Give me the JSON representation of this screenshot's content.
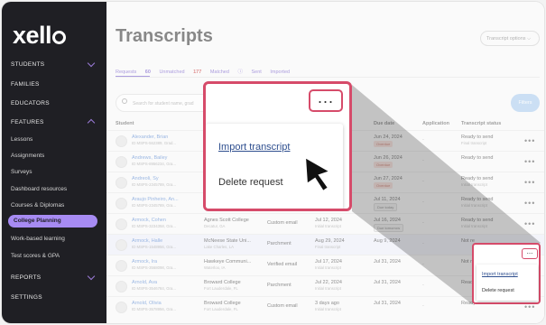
{
  "app": {
    "logo": "xell",
    "logo_suffix": "o"
  },
  "sidebar": {
    "sections": [
      {
        "label": "STUDENTS",
        "chevron": "down"
      },
      {
        "label": "FAMILIES"
      },
      {
        "label": "EDUCATORS"
      },
      {
        "label": "FEATURES",
        "chevron": "up"
      }
    ],
    "features_items": [
      "Lessons",
      "Assignments",
      "Surveys",
      "Dashboard resources",
      "Courses & Diplomas"
    ],
    "active_item": "College Planning",
    "after_items": [
      "Work-based learning",
      "Test scores & GPA"
    ],
    "bottom_sections": [
      {
        "label": "REPORTS",
        "chevron": "down"
      },
      {
        "label": "SETTINGS"
      }
    ]
  },
  "header": {
    "title": "Transcripts",
    "options_button": "Transcript options"
  },
  "tabs": [
    {
      "label": "Requests",
      "count": "60"
    },
    {
      "label": "Unmatched",
      "count": "177"
    },
    {
      "label": "Matched",
      "count": ""
    },
    {
      "label": "Sent",
      "count": ""
    },
    {
      "label": "Imported",
      "count": ""
    }
  ],
  "search": {
    "placeholder": "Search for student name, grad"
  },
  "filters_button": "Filters",
  "table": {
    "headers": {
      "student": "Student",
      "due_date": "Due date",
      "application": "Application",
      "status": "Transcript status"
    },
    "rows": [
      {
        "name": "Alexander, Brian",
        "id": "ID MSPS-562389, Grad...",
        "college": "",
        "college_loc": "",
        "method": "",
        "received": "",
        "received_sub": "",
        "due": "Jun 24, 2024",
        "badge": "Overdue",
        "badge_type": "over",
        "app": "-",
        "status": "Ready to send",
        "status_sub": "Final transcript"
      },
      {
        "name": "Andrews, Bailey",
        "id": "ID MSPS-8956234, Gra...",
        "college": "",
        "college_loc": "",
        "method": "",
        "received": "",
        "received_sub": "",
        "due": "Jun 26, 2024",
        "badge": "Overdue",
        "badge_type": "over",
        "app": "-",
        "status": "Ready to send",
        "status_sub": ""
      },
      {
        "name": "Andreoli, Sy",
        "id": "ID MSPS-2345789, Gra...",
        "college": "",
        "college_loc": "",
        "method": "",
        "received": "",
        "received_sub": "",
        "due": "Jun 27, 2024",
        "badge": "Overdue",
        "badge_type": "over",
        "app": "-",
        "status": "Ready to send",
        "status_sub": "Initial transcript"
      },
      {
        "name": "Araujo Pinheiro, An...",
        "id": "ID MSPS-2345789, Gra...",
        "college": "",
        "college_loc": "",
        "method": "",
        "received": "",
        "received_sub": "",
        "due": "Jul 11, 2024",
        "badge": "Due today",
        "badge_type": "ok",
        "app": "-",
        "status": "Ready to send",
        "status_sub": "Initial transcript"
      },
      {
        "name": "Armock, Cohen",
        "id": "ID MSPS-3234358, Gra...",
        "college": "Agnes Scott College",
        "college_loc": "Decatur, GA",
        "method": "Custom email",
        "received": "Jul 12, 2024",
        "received_sub": "Initial transcript",
        "due": "Jul 16, 2024",
        "badge": "Due tomorrow",
        "badge_type": "ok",
        "app": "-",
        "status": "Ready to send",
        "status_sub": "Initial transcript"
      },
      {
        "name": "Armock, Halle",
        "id": "ID MSPS-1548956, Gra...",
        "college": "McNeese State Uni...",
        "college_loc": "Lake Charles, LA",
        "method": "Parchment",
        "received": "Aug 29, 2024",
        "received_sub": "Final transcript",
        "due": "Aug 9, 2024",
        "badge": "",
        "badge_type": "",
        "app": "-",
        "status": "Not re",
        "status_sub": ""
      },
      {
        "name": "Armock, Ira",
        "id": "ID MSPS-3568098, Gra...",
        "college": "Hawkeye Communi...",
        "college_loc": "Waterloo, IA",
        "method": "Verified email",
        "received": "Jul 17, 2024",
        "received_sub": "Initial transcript",
        "due": "Jul 31, 2024",
        "badge": "",
        "badge_type": "",
        "app": "-",
        "status": "Not re",
        "status_sub": ""
      },
      {
        "name": "Arnold, Ava",
        "id": "ID MSPS-3546784, Gra...",
        "college": "Broward College",
        "college_loc": "Fort Lauderdale, FL",
        "method": "Parchment",
        "received": "Jul 22, 2024",
        "received_sub": "Initial transcript",
        "due": "Jul 31, 2024",
        "badge": "",
        "badge_type": "",
        "app": "-",
        "status": "Ready",
        "status_sub": ""
      },
      {
        "name": "Arnold, Olivia",
        "id": "ID MSPS-3578956, Gra...",
        "college": "Broward College",
        "college_loc": "Fort Lauderdale, FL",
        "method": "Custom email",
        "received": "3 days ago",
        "received_sub": "Initial transcript",
        "due": "Jul 31, 2024",
        "badge": "",
        "badge_type": "",
        "app": "-",
        "status": "Ready to send",
        "status_sub": ""
      }
    ]
  },
  "row_menu": {
    "import": "Import transcript",
    "delete": "Delete request"
  },
  "colors": {
    "accent": "#a78bf3",
    "highlight": "#d64b6a",
    "sidebar_bg": "#1f1f24",
    "link": "#4b7fcf"
  }
}
